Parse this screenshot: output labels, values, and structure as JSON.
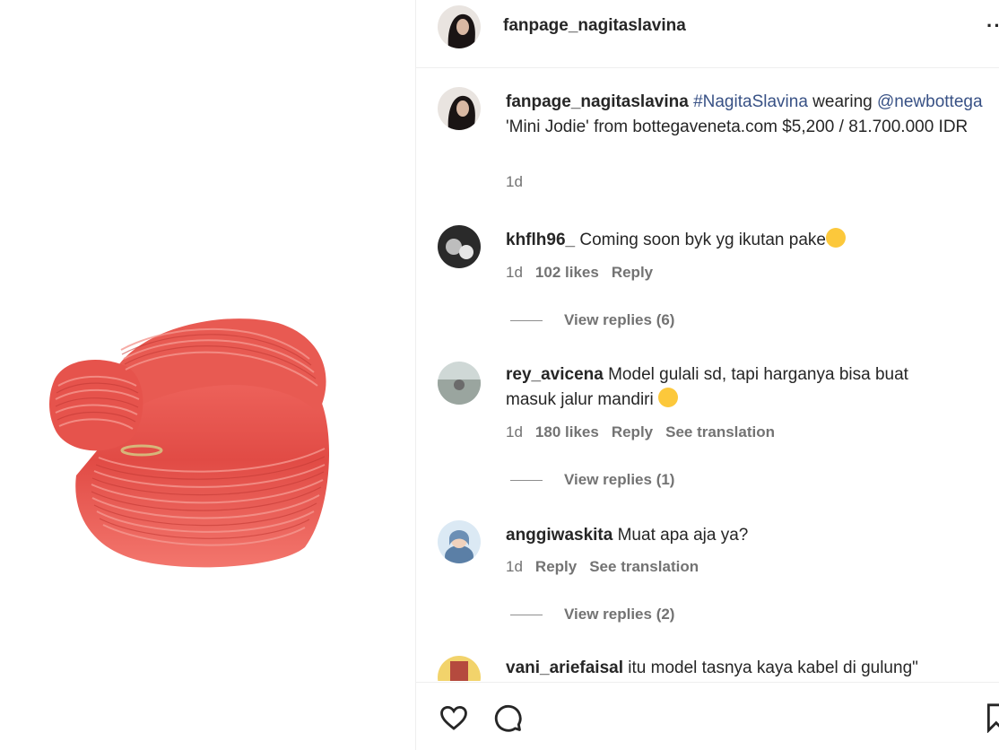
{
  "post": {
    "username": "fanpage_nagitaslavina",
    "more_label": "··",
    "caption": {
      "username": "fanpage_nagitaslavina",
      "hashtag": "#NagitaSlavina",
      "text_1": " wearing ",
      "mention": "@newbottega",
      "text_2": " 'Mini Jodie' from bottegaveneta.com $5,200 / 81.700.000 IDR",
      "time": "1d"
    }
  },
  "comments": [
    {
      "username": "khflh96_",
      "text": "Coming soon byk yg ikutan pake",
      "emoji": "laughing-emoji",
      "time": "1d",
      "likes": "102 likes",
      "reply": "Reply",
      "translate": "",
      "view_replies": "View replies (6)"
    },
    {
      "username": "rey_avicena",
      "text": "Model gulali sd, tapi harganya bisa buat masuk jalur mandiri",
      "emoji": "crying-emoji",
      "time": "1d",
      "likes": "180 likes",
      "reply": "Reply",
      "translate": "See translation",
      "view_replies": "View replies (1)"
    },
    {
      "username": "anggiwaskita",
      "text": "Muat apa aja ya?",
      "time": "1d",
      "likes": "",
      "reply": "Reply",
      "translate": "See translation",
      "view_replies": "View replies (2)"
    },
    {
      "username": "vani_ariefaisal",
      "text": "itu model tasnya kaya kabel di gulung\""
    }
  ],
  "icons": {
    "like": "heart-icon",
    "comment": "comment-icon",
    "save": "bookmark-icon"
  },
  "colors": {
    "link": "#385185",
    "bag": "#e8504a"
  }
}
